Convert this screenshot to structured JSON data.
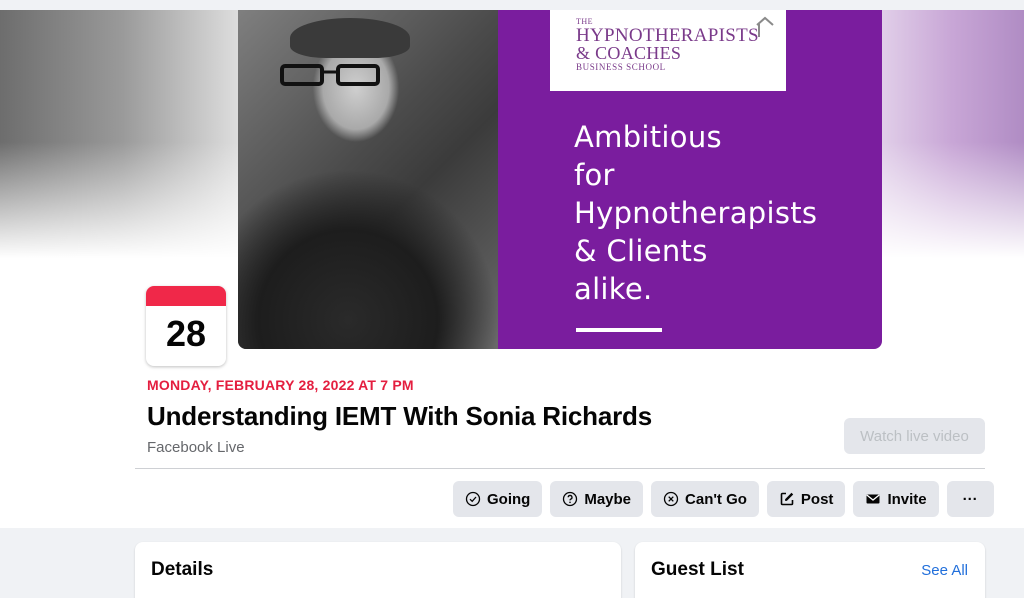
{
  "cover": {
    "logo_line1": "THE",
    "logo_line2": "HYPNOTHERAPISTS",
    "logo_line3": "& COACHES",
    "logo_line4": "BUSINESS SCHOOL",
    "tagline": [
      "Ambitious",
      "for",
      "Hypnotherapists",
      "& Clients",
      "alike."
    ],
    "promo_color": "#7a1d9e"
  },
  "event": {
    "day": "28",
    "date_label": "MONDAY, FEBRUARY 28, 2022 AT 7 PM",
    "title": "Understanding IEMT With Sonia Richards",
    "location": "Facebook Live",
    "date_color": "#e41e3f"
  },
  "watch_button": "Watch live video",
  "actions": {
    "going": "Going",
    "maybe": "Maybe",
    "cant_go": "Can't Go",
    "post": "Post",
    "invite": "Invite",
    "more": "···"
  },
  "details": {
    "title": "Details"
  },
  "guests": {
    "title": "Guest List",
    "see_all": "See All"
  }
}
